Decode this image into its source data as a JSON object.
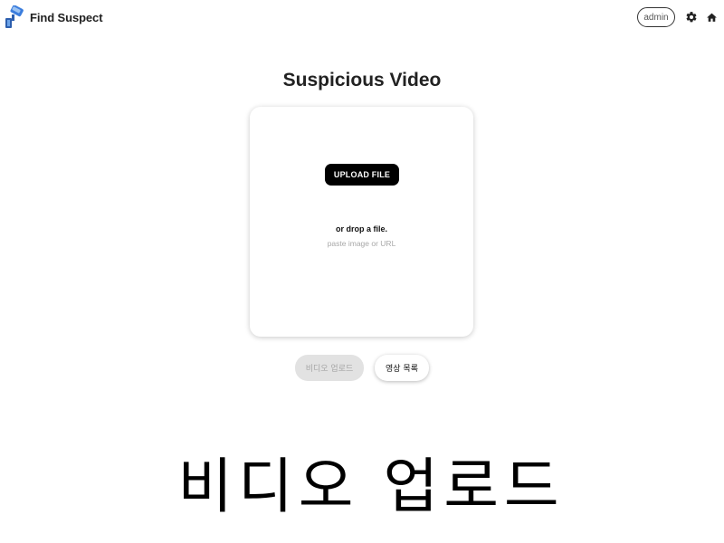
{
  "header": {
    "app_name": "Find Suspect",
    "logo_icon": "cctv-camera-icon",
    "user_label": "admin",
    "settings_icon": "gear-icon",
    "home_icon": "home-icon"
  },
  "main": {
    "title": "Suspicious Video",
    "upload": {
      "button_label": "UPLOAD FILE",
      "drop_text": "or drop a file.",
      "url_hint": "paste image or URL"
    },
    "actions": {
      "video_upload_label": "비디오 업로드",
      "video_list_label": "영상 목록"
    }
  },
  "caption": "비디오 업로드",
  "colors": {
    "logo_blue": "#3b7ddd",
    "upload_button_bg": "#000000",
    "disabled_button_bg": "#e2e2e2",
    "disabled_button_text": "#a6a6a6"
  }
}
